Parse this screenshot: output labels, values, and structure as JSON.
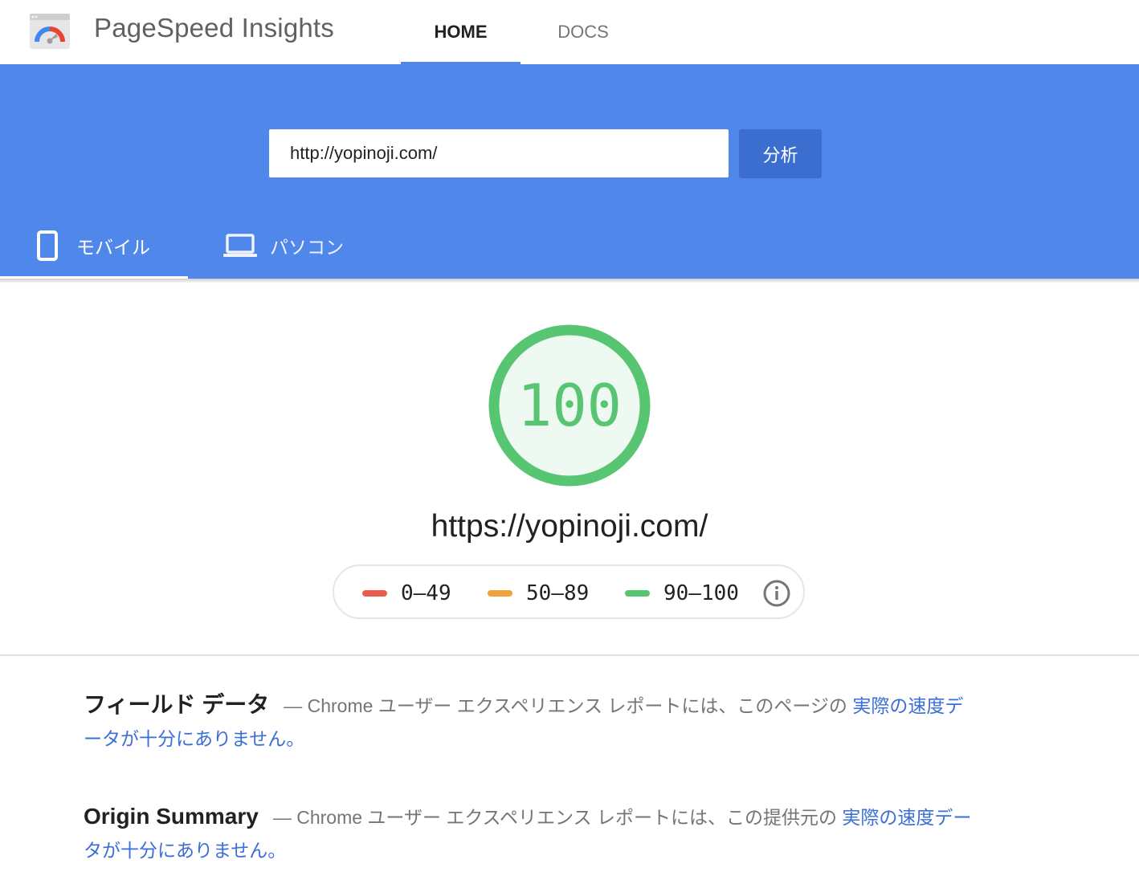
{
  "header": {
    "app_title": "PageSpeed Insights",
    "nav": {
      "home": "HOME",
      "docs": "DOCS"
    }
  },
  "search": {
    "url_value": "http://yopinoji.com/",
    "analyze_label": "分析"
  },
  "device_tabs": {
    "mobile": "モバイル",
    "desktop": "パソコン",
    "selected": "mobile"
  },
  "score": {
    "value": "100",
    "fraction": 1.0,
    "tested_url": "https://yopinoji.com/"
  },
  "legend": {
    "items": [
      {
        "label": "0–49",
        "color": "#eb5a4f"
      },
      {
        "label": "50–89",
        "color": "#f1a23b"
      },
      {
        "label": "90–100",
        "color": "#58c572"
      }
    ]
  },
  "field_data": {
    "title": "フィールド データ",
    "description": "— Chrome ユーザー エクスペリエンス レポートには、このページの",
    "link": "実際の速度データが十分にありません。"
  },
  "origin_summary": {
    "title": "Origin Summary",
    "description": "— Chrome ユーザー エクスペリエンス レポートには、この提供元の",
    "link": "実際の速度データが十分にありません。"
  },
  "colors": {
    "brand_blue": "#5087eb",
    "button_blue": "#3c6ed0",
    "link_blue": "#3b6ed6",
    "score_green": "#58c572"
  }
}
